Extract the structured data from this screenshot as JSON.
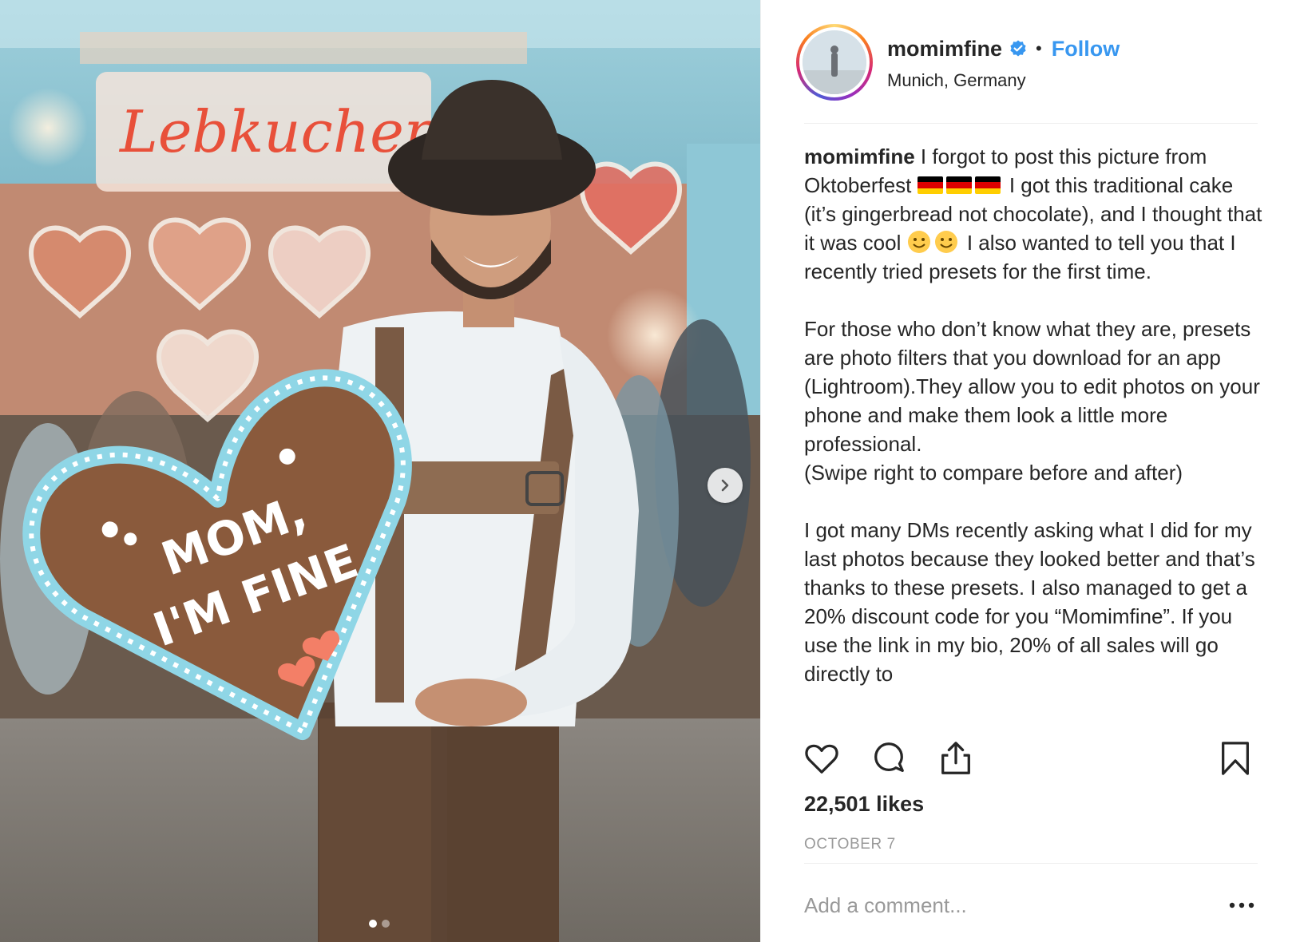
{
  "photo": {
    "sign_text": "Lebkuchen",
    "cookie_line1": "MOM,",
    "cookie_line2": "I'M FINE",
    "carousel_count": 2,
    "carousel_active": 0,
    "next_icon": "chevron-right-icon"
  },
  "header": {
    "username": "momimfine",
    "verified_icon": "verified-badge-icon",
    "separator": "•",
    "follow_label": "Follow",
    "location": "Munich, Germany"
  },
  "caption": {
    "username": "momimfine",
    "p1_a": " I forgot to post this picture from Oktoberfest ",
    "p1_b": " I got this traditional cake (it’s gingerbread not chocolate), and I thought that it was cool ",
    "p1_c": " I also wanted to tell you that I recently tried presets for the first time.",
    "p2": "For those who don’t know what they are, presets are photo filters that you download for an app (Lightroom).They allow you to edit photos on your phone and make them look a little more professional.",
    "p2_b": "(Swipe right to compare before and after)",
    "p3": "I got many DMs recently asking what I did for my last photos because they looked better and that’s thanks to these presets. I also managed to get a 20% discount code for you “Momimfine”. If you use the link in my bio, 20% of all sales will go directly to"
  },
  "actions": {
    "like_icon": "heart-icon",
    "comment_icon": "comment-bubble-icon",
    "share_icon": "share-icon",
    "save_icon": "bookmark-icon"
  },
  "likes": "22,501 likes",
  "date": "OCTOBER 7",
  "comment": {
    "placeholder": "Add a comment...",
    "more_icon": "ellipsis-icon"
  },
  "colors": {
    "link_blue": "#3897f0",
    "text": "#262626",
    "muted": "#999999",
    "divider": "#efefef"
  }
}
